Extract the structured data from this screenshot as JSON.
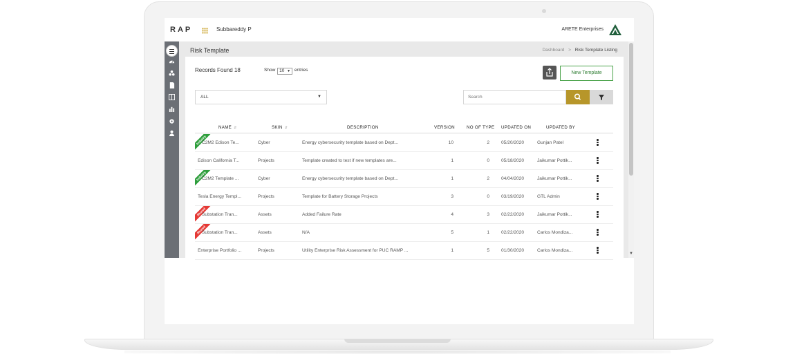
{
  "header": {
    "logo_text": "RAP",
    "user_name": "Subbareddy P",
    "org_name": "ARETE Enterprises"
  },
  "page": {
    "title": "Risk Template",
    "breadcrumb": [
      "Dashboard",
      "Risk Template Listing"
    ],
    "breadcrumb_sep": ">"
  },
  "toolbar": {
    "records_found": "Records Found 18",
    "show_label": "Show",
    "show_value": "10",
    "entries_label": "entries",
    "new_template_label": "New Template",
    "skin_filter_value": "ALL",
    "search_placeholder": "Search"
  },
  "table": {
    "columns": [
      "NAME",
      "SKIN",
      "DESCRIPTION",
      "VERSION",
      "NO OF TYPE",
      "UPDATED ON",
      "UPDATED BY"
    ],
    "rows": [
      {
        "name": "C2M2 Edison Te...",
        "skin": "Cyber",
        "description": "Energy cybersecurity template based on Dept...",
        "version": "10",
        "types": "2",
        "updated_on": "05/20/2020",
        "updated_by": "Gunjan Patel",
        "ribbon": "Industry",
        "ribbon_color": "#2e9e3c"
      },
      {
        "name": "Edison California T...",
        "skin": "Projects",
        "description": "Template created to test if new templates are...",
        "version": "1",
        "types": "0",
        "updated_on": "05/18/2020",
        "updated_by": "Jaikumar Pottik...",
        "ribbon": "",
        "ribbon_color": ""
      },
      {
        "name": "C2M2 Template ...",
        "skin": "Cyber",
        "description": "Energy cybersecurity template based on Dept...",
        "version": "1",
        "types": "2",
        "updated_on": "04/04/2020",
        "updated_by": "Jaikumar Pottik...",
        "ribbon": "Industry",
        "ribbon_color": "#2e9e3c"
      },
      {
        "name": "Tesla Energy Templ...",
        "skin": "Projects",
        "description": "Template for Battery Storage Projects",
        "version": "3",
        "types": "0",
        "updated_on": "03/19/2020",
        "updated_by": "GTL Admin",
        "ribbon": "",
        "ribbon_color": ""
      },
      {
        "name": "Substation Tran...",
        "skin": "Assets",
        "description": "Added Failure Rate",
        "version": "4",
        "types": "3",
        "updated_on": "02/22/2020",
        "updated_by": "Jaikumar Pottik...",
        "ribbon": "Shared",
        "ribbon_color": "#e53935"
      },
      {
        "name": "Substation Tran...",
        "skin": "Assets",
        "description": "N/A",
        "version": "5",
        "types": "1",
        "updated_on": "02/22/2020",
        "updated_by": "Carlos Mondiza...",
        "ribbon": "Shared",
        "ribbon_color": "#e53935"
      },
      {
        "name": "Enterprise Portfolio ...",
        "skin": "Projects",
        "description": "Utility Enterprise Risk Assessment for PUC RAMP ...",
        "version": "1",
        "types": "5",
        "updated_on": "01/30/2020",
        "updated_by": "Carlos Mondiza...",
        "ribbon": "",
        "ribbon_color": ""
      }
    ]
  },
  "colors": {
    "accent_gold": "#b7962a",
    "sidebar": "#6b6f75",
    "green_button": "#4aa34a"
  }
}
